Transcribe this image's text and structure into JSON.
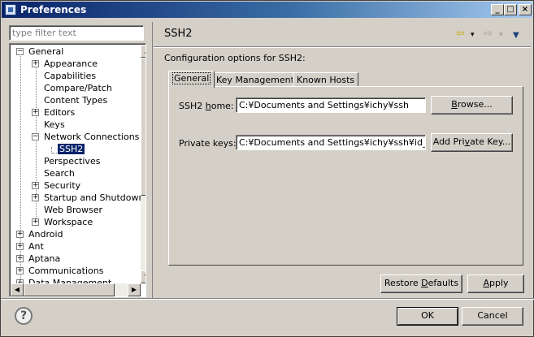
{
  "window": {
    "title": "Preferences",
    "controls": {
      "minimize": "_",
      "maximize": "□",
      "close": "×"
    }
  },
  "filter": {
    "placeholder": "type filter text"
  },
  "tree": {
    "items": [
      {
        "label": "General",
        "expander": "−"
      },
      {
        "label": "Appearance",
        "expander": "+"
      },
      {
        "label": "Capabilities",
        "expander": ""
      },
      {
        "label": "Compare/Patch",
        "expander": ""
      },
      {
        "label": "Content Types",
        "expander": ""
      },
      {
        "label": "Editors",
        "expander": "+"
      },
      {
        "label": "Keys",
        "expander": ""
      },
      {
        "label": "Network Connections",
        "expander": "−"
      },
      {
        "label": "SSH2",
        "expander": "",
        "selected": true
      },
      {
        "label": "Perspectives",
        "expander": ""
      },
      {
        "label": "Search",
        "expander": ""
      },
      {
        "label": "Security",
        "expander": "+"
      },
      {
        "label": "Startup and Shutdown",
        "expander": "+"
      },
      {
        "label": "Web Browser",
        "expander": ""
      },
      {
        "label": "Workspace",
        "expander": "+"
      },
      {
        "label": "Android",
        "expander": "+"
      },
      {
        "label": "Ant",
        "expander": "+"
      },
      {
        "label": "Aptana",
        "expander": "+"
      },
      {
        "label": "Communications",
        "expander": "+"
      },
      {
        "label": "Data Management",
        "expander": "+"
      }
    ],
    "scroll": {
      "up": "▲",
      "down": "▼",
      "left": "◀",
      "right": "▶"
    }
  },
  "page": {
    "title": "SSH2",
    "description": "Configuration options for SSH2:",
    "nav": {
      "back": "⇦",
      "forward": "⇨",
      "dropdown": "▾",
      "menu": "▼"
    }
  },
  "tabs": [
    {
      "label": "General",
      "active": true
    },
    {
      "label": "Key Management",
      "active": false
    },
    {
      "label": "Known Hosts",
      "active": false
    }
  ],
  "general_tab": {
    "ssh2_home": {
      "label_prefix": "SSH2 ",
      "label_mnemonic": "h",
      "label_suffix": "ome:",
      "value": "C:¥Documents and Settings¥ichy¥ssh",
      "button_prefix": "",
      "button_mnemonic": "B",
      "button_suffix": "rowse..."
    },
    "private_keys": {
      "label": "Private keys:",
      "value": "C:¥Documents and Settings¥ichy¥ssh¥id_rsa",
      "button_prefix": "Add Pri",
      "button_mnemonic": "v",
      "button_suffix": "ate Key..."
    }
  },
  "actions": {
    "restore_prefix": "Restore ",
    "restore_mnemonic": "D",
    "restore_suffix": "efaults",
    "apply_mnemonic": "A",
    "apply_suffix": "pply",
    "ok": "OK",
    "cancel": "Cancel",
    "help": "?"
  }
}
